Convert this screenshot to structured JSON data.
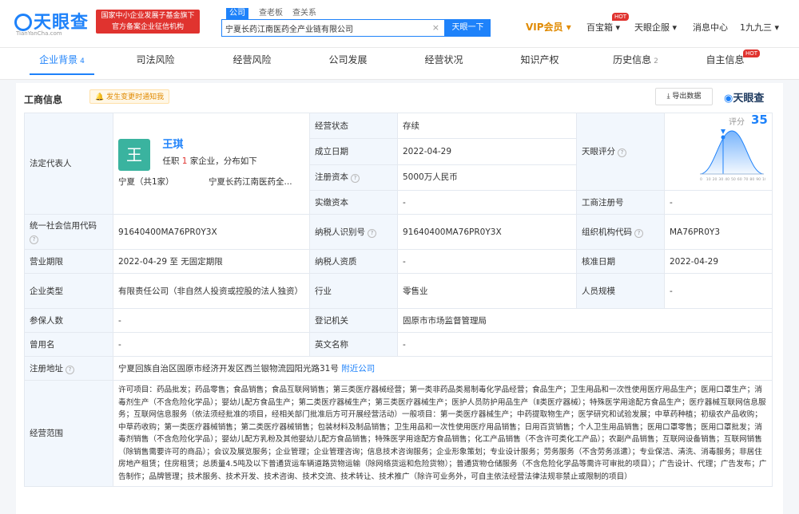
{
  "header": {
    "logo": "天眼查",
    "logo_sub": "TianYanCha.com",
    "badge_line1": "国家中小企业发展子基金旗下",
    "badge_line2": "官方备案企业征信机构",
    "search_tabs": [
      "公司",
      "查老板",
      "查关系"
    ],
    "search_value": "宁夏长药江南医药全产业链有限公司",
    "search_button": "天眼一下",
    "vip": "VIP会员",
    "baibaoxiang": "百宝箱",
    "qiyeban": "天眼企服",
    "messages": "消息中心",
    "user": "1九九三",
    "hot": "HOT"
  },
  "tabs": [
    {
      "label": "企业背景",
      "count": "4"
    },
    {
      "label": "司法风险",
      "count": ""
    },
    {
      "label": "经营风险",
      "count": ""
    },
    {
      "label": "公司发展",
      "count": ""
    },
    {
      "label": "经营状况",
      "count": ""
    },
    {
      "label": "知识产权",
      "count": ""
    },
    {
      "label": "历史信息",
      "count": "2"
    },
    {
      "label": "自主信息",
      "count": ""
    }
  ],
  "section": {
    "title": "工商信息",
    "notice": "发生变更时通知我",
    "export": "导出数据",
    "brand": "天眼查"
  },
  "legal_rep": {
    "label": "法定代表人",
    "avatar": "王",
    "name": "王琪",
    "role_prefix": "任职",
    "role_count": "1",
    "role_suffix": "家企业，分布如下",
    "region": "宁夏（共1家）",
    "company": "宁夏长药江南医药全..."
  },
  "fields": {
    "status_label": "经营状态",
    "status": "存续",
    "est_label": "成立日期",
    "est": "2022-04-29",
    "capital_label": "注册资本",
    "capital": "5000万人民币",
    "paid_label": "实缴资本",
    "paid": "-",
    "score_label": "天眼评分",
    "score_text": "评分",
    "score": "35",
    "regno_label": "工商注册号",
    "regno": "-",
    "credit_label": "统一社会信用代码",
    "credit": "91640400MA76PR0Y3X",
    "taxid_label": "纳税人识别号",
    "taxid": "91640400MA76PR0Y3X",
    "org_label": "组织机构代码",
    "org": "MA76PR0Y3",
    "term_label": "营业期限",
    "term": "2022-04-29  至  无固定期限",
    "taxq_label": "纳税人资质",
    "taxq": "-",
    "approve_label": "核准日期",
    "approve": "2022-04-29",
    "type_label": "企业类型",
    "type": "有限责任公司（非自然人投资或控股的法人独资）",
    "industry_label": "行业",
    "industry": "零售业",
    "staff_label": "人员规模",
    "staff": "-",
    "insured_label": "参保人数",
    "insured": "-",
    "authority_label": "登记机关",
    "authority": "固原市市场监督管理局",
    "former_label": "曾用名",
    "former": "-",
    "english_label": "英文名称",
    "english": "-",
    "address_label": "注册地址",
    "address": "宁夏回族自治区固原市经济开发区西兰银物流园阳光路31号",
    "nearby": "附近公司",
    "scope_label": "经营范围",
    "scope": "许可项目：药品批发；药品零售；食品销售；食品互联网销售；第三类医疗器械经营；第一类非药品类易制毒化学品经营；食品生产；卫生用品和一次性使用医疗用品生产；医用口罩生产；消毒剂生产（不含危险化学品）；婴幼儿配方食品生产；第二类医疗器械生产；第三类医疗器械生产；医护人员防护用品生产（Ⅱ类医疗器械）；特殊医学用途配方食品生产；医疗器械互联网信息服务；互联网信息服务（依法须经批准的项目，经相关部门批准后方可开展经营活动）一般项目：第一类医疗器械生产；中药提取物生产；医学研究和试验发展；中草药种植；初级农产品收购；中草药收购；第一类医疗器械销售；第二类医疗器械销售；包装材料及制品销售；卫生用品和一次性使用医疗用品销售；日用百货销售；个人卫生用品销售；医用口罩零售；医用口罩批发；消毒剂销售（不含危险化学品）；婴幼儿配方乳粉及其他婴幼儿配方食品销售；特殊医学用途配方食品销售；化工产品销售（不含许可类化工产品）；农副产品销售；互联网设备销售；互联网销售（除销售需要许可的商品）；会议及展览服务；企业管理；企业管理咨询；信息技术咨询服务；企业形象策划；专业设计服务；劳务服务（不含劳务派遣）；专业保洁、清洗、消毒服务；非居住房地产租赁；住房租赁；总质量4.5吨及以下普通货运车辆道路货物运输（除网络货运和危险货物）；普通货物仓储服务（不含危险化学品等需许可审批的项目）；广告设计、代理；广告发布；广告制作；品牌管理；技术服务、技术开发、技术咨询、技术交流、技术转让、技术推广（除许可业务外，可自主依法经营法律法规非禁止或限制的项目）"
  },
  "score_axis": [
    "0",
    "10",
    "20",
    "30",
    "40",
    "50",
    "60",
    "70",
    "80",
    "90",
    "100"
  ],
  "colors": {
    "accent": "#1e82fa",
    "hot": "#e0332f",
    "vip": "#e08a00",
    "avatar": "#3ab39f"
  }
}
